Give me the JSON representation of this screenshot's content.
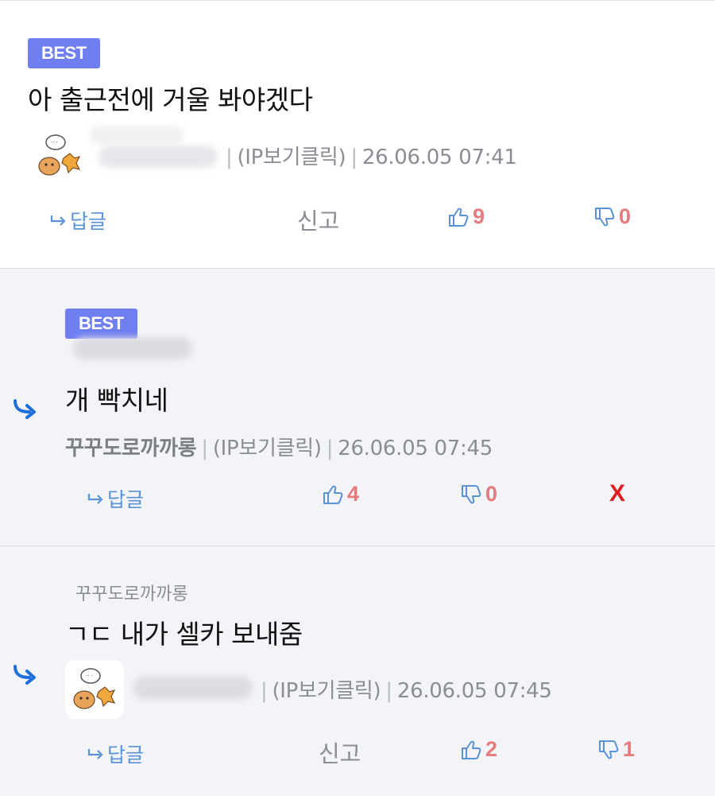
{
  "comments": [
    {
      "badge": "BEST",
      "text": "아 출근전에 거울 봐야겠다",
      "meta": {
        "ip": "(IP보기클릭)",
        "date": "26.06.05 07:41"
      },
      "actions": {
        "reply": "답글",
        "report": "신고",
        "likes": "9",
        "dislikes": "0"
      }
    },
    {
      "badge": "BEST",
      "text": "개 빡치네",
      "meta": {
        "nickname": "꾸꾸도로까까롱",
        "ip": "(IP보기클릭)",
        "date": "26.06.05 07:45"
      },
      "actions": {
        "reply": "답글",
        "likes": "4",
        "dislikes": "0",
        "delete": "X"
      }
    },
    {
      "parent_nickname": "꾸꾸도로까까롱",
      "text": "ㄱㄷ 내가 셀카 보내줌",
      "meta": {
        "ip": "(IP보기클릭)",
        "date": "26.06.05 07:45"
      },
      "actions": {
        "reply": "답글",
        "report": "신고",
        "likes": "2",
        "dislikes": "1"
      }
    }
  ],
  "icons": {
    "reply_arrow": "reply-arrow-icon",
    "thumbs_up": "thumbs-up-icon",
    "thumbs_down": "thumbs-down-icon",
    "small_reply": "reply-small-arrow-icon"
  },
  "colors": {
    "best_badge": "#6f7ff0",
    "vote_count": "#e77a7a",
    "reply_link": "#5b92d6",
    "delete": "#e11d1d",
    "reply_bg": "#f3f4f7"
  }
}
